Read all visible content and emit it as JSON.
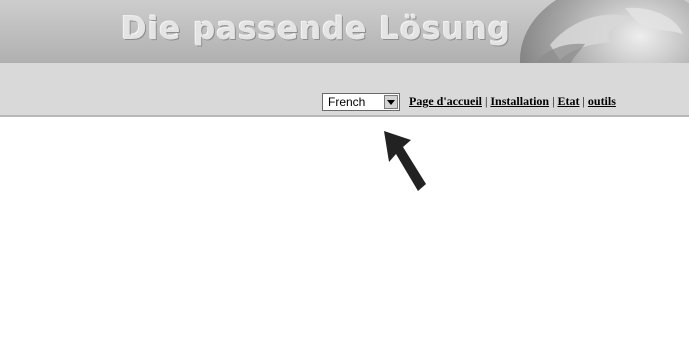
{
  "banner": {
    "title": "Die passende Lösung"
  },
  "language": {
    "selected": "French"
  },
  "nav": {
    "links": [
      "Page d'accueil",
      "Installation",
      "Etat",
      "outils"
    ],
    "separator": "|"
  },
  "icons": {
    "pointer": "arrow-pointer-icon",
    "dropdown": "chevron-down-icon",
    "banner_art": "globe-icon"
  }
}
